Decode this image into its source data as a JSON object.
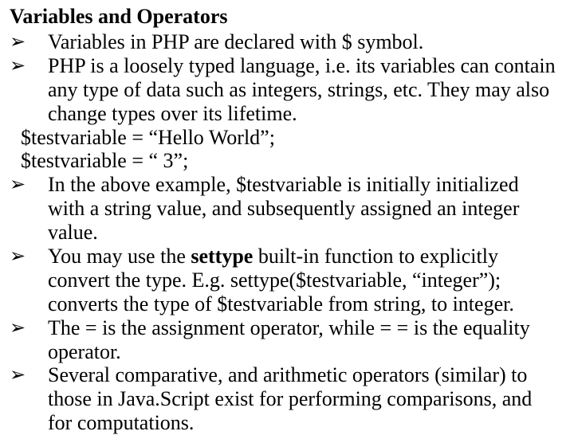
{
  "glyphs": {
    "arrow": "➢"
  },
  "title": "Variables and Operators",
  "items": {
    "b1": "Variables in PHP are declared with $ symbol.",
    "b2": "PHP is a loosely typed language, i.e. its variables can contain any type of data such as integers, strings, etc. They may also change types over its lifetime.",
    "code1": "$testvariable = “Hello World”;",
    "code2": "$testvariable = “ 3”;",
    "b3": "In the above example, $testvariable is initially initialized with a string value, and subsequently assigned an integer value.",
    "b4_pre": "You may use the ",
    "b4_bold": "settype",
    "b4_post": " built-in function to explicitly convert the type. E.g. settype($testvariable, “integer”); converts the type of $testvariable from string, to integer.",
    "b5": "The = is the assignment operator, while = = is the equality operator.",
    "b6": "Several comparative, and arithmetic operators (similar) to those in Java.Script exist for performing comparisons, and for computations."
  }
}
